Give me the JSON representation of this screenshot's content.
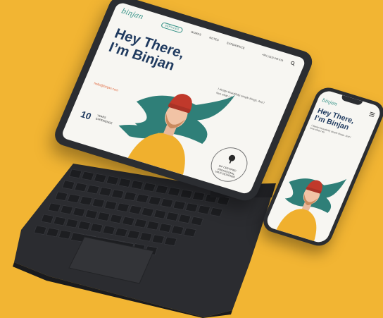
{
  "background_color": "#f2b533",
  "tablet": {
    "logo": "binjan",
    "nav": [
      "SERVICES",
      "WORKS",
      "NOTES",
      "EXPERIENCE"
    ],
    "phone_number": "+001 (313) 345 678",
    "heading_line1": "Hey There,",
    "heading_line2": "I’m Binjan",
    "description": "I design beautifully simple things. And I love what I do.",
    "email": "hello@binjan.com",
    "years_number": "10",
    "years_label_line1": "YEARS",
    "years_label_line2": "EXPERIENCE",
    "badge_line1": "IDF CERTIFIED",
    "badge_line2": "PROFATIONAL",
    "badge_line3": "UI/UX DESIGNER"
  },
  "phone": {
    "logo": "binjan",
    "heading_line1": "Hey There,",
    "heading_line2": "I’m Binjan",
    "description": "I design beautifully simple things. And I love what I do."
  },
  "icons": {
    "search": "search-icon",
    "menu": "menu-icon",
    "tree": "tree-icon"
  },
  "colors": {
    "accent_teal": "#2f8f83",
    "heading_navy": "#1f3a5f",
    "email_orange": "#e0683e",
    "sweater_yellow": "#f0b02e",
    "hat_red": "#c0392b",
    "device_dark": "#2b2d31"
  }
}
